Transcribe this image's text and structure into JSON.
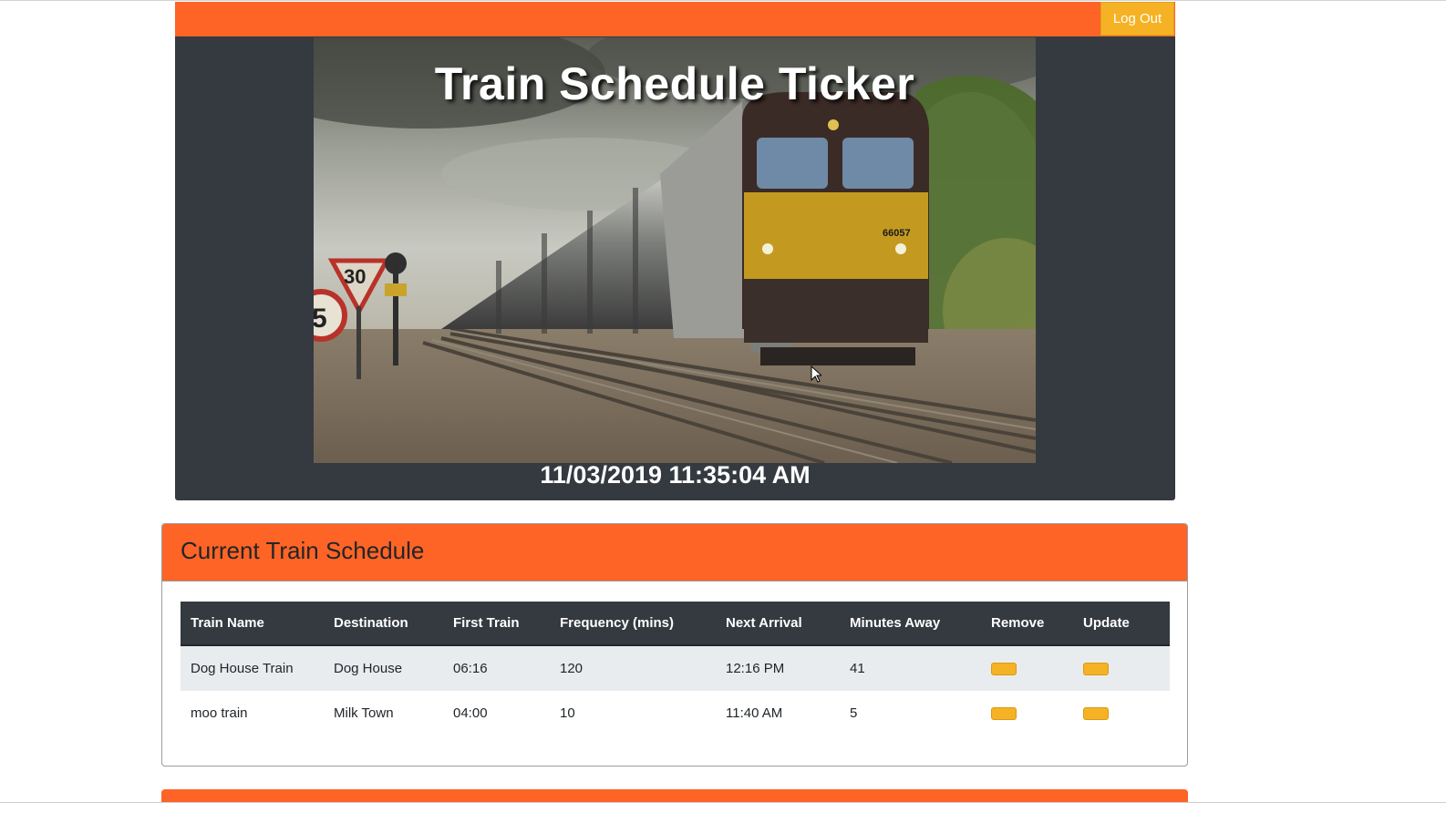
{
  "navbar": {
    "logout_label": "Log Out",
    "brand_color": "#fe6426",
    "button_color": "#f6b225"
  },
  "hero": {
    "title": "Train Schedule Ticker",
    "datetime": "11/03/2019 11:35:04 AM",
    "image_description_icon": "train-photo",
    "photo_texts": {
      "speed_sign": "30",
      "round_sign": "5",
      "loco_number": "66057"
    }
  },
  "schedule": {
    "title": "Current Train Schedule",
    "columns": [
      "Train Name",
      "Destination",
      "First Train",
      "Frequency (mins)",
      "Next Arrival",
      "Minutes Away",
      "Remove",
      "Update"
    ],
    "rows": [
      {
        "name": "Dog House Train",
        "destination": "Dog House",
        "first_train": "06:16",
        "frequency": "120",
        "next_arrival": "12:16 PM",
        "minutes_away": "41"
      },
      {
        "name": "moo train",
        "destination": "Milk Town",
        "first_train": "04:00",
        "frequency": "10",
        "next_arrival": "11:40 AM",
        "minutes_away": "5"
      }
    ]
  }
}
